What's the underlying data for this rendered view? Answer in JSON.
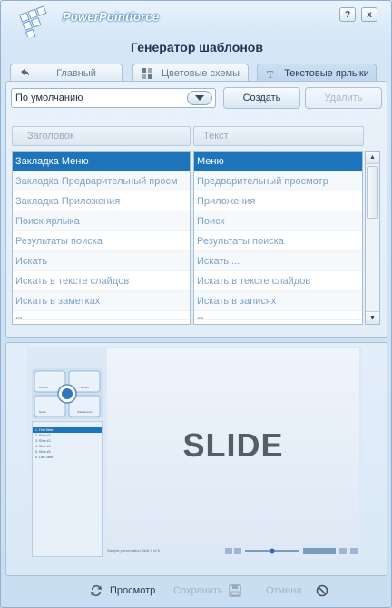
{
  "window": {
    "brand": "PowerPointforce",
    "title": "Генератор шаблонов",
    "help_label": "?",
    "close_label": "x"
  },
  "tabs": [
    {
      "label": "Главный",
      "icon": "undo-arrow-icon"
    },
    {
      "label": "Цветовые схемы",
      "icon": "color-grid-icon"
    },
    {
      "label": "Текстовые ярлыки",
      "icon": "text-label-icon",
      "active": true
    }
  ],
  "preset": {
    "selected": "По умолчанию",
    "create_label": "Создать",
    "delete_label": "Удалить"
  },
  "columns": {
    "header_label": "Заголовок",
    "text_label": "Текст"
  },
  "rows": [
    {
      "key": "Закладка Меню",
      "value": "Меню",
      "selected": true
    },
    {
      "key": "Закладка Предварительный просм",
      "value": "Предварительный просмотр"
    },
    {
      "key": "Закладка Приложения",
      "value": "Приложения"
    },
    {
      "key": "Поиск ярлыка",
      "value": "Поиск"
    },
    {
      "key": "Результаты поиска",
      "value": "Результаты поиска"
    },
    {
      "key": "Искать",
      "value": "Искать...."
    },
    {
      "key": "Искать в тексте слайдов",
      "value": "Искать в тексте слайдов"
    },
    {
      "key": "Искать в заметках",
      "value": "Искать в записях"
    },
    {
      "key": "Поиск не дал результатов",
      "value": "Поиск не дал результатов"
    }
  ],
  "preview": {
    "slide_text": "SLIDE",
    "nav_items": [
      "1. First Slide",
      "2. Slide #2",
      "3. Slide #3",
      "4. Slide #4",
      "5. Slide #5",
      "6. Last Slide"
    ],
    "menu_labels": [
      "Outline",
      "Thumbs",
      "Notes",
      "Attachments"
    ],
    "caption": "Sample presentation   Slide 1 of 6"
  },
  "footer": {
    "preview_label": "Просмотр",
    "save_label": "Сохранить",
    "cancel_label": "Отмена"
  },
  "colors": {
    "accent": "#1e74bb",
    "muted_text": "#7fa3c6"
  }
}
